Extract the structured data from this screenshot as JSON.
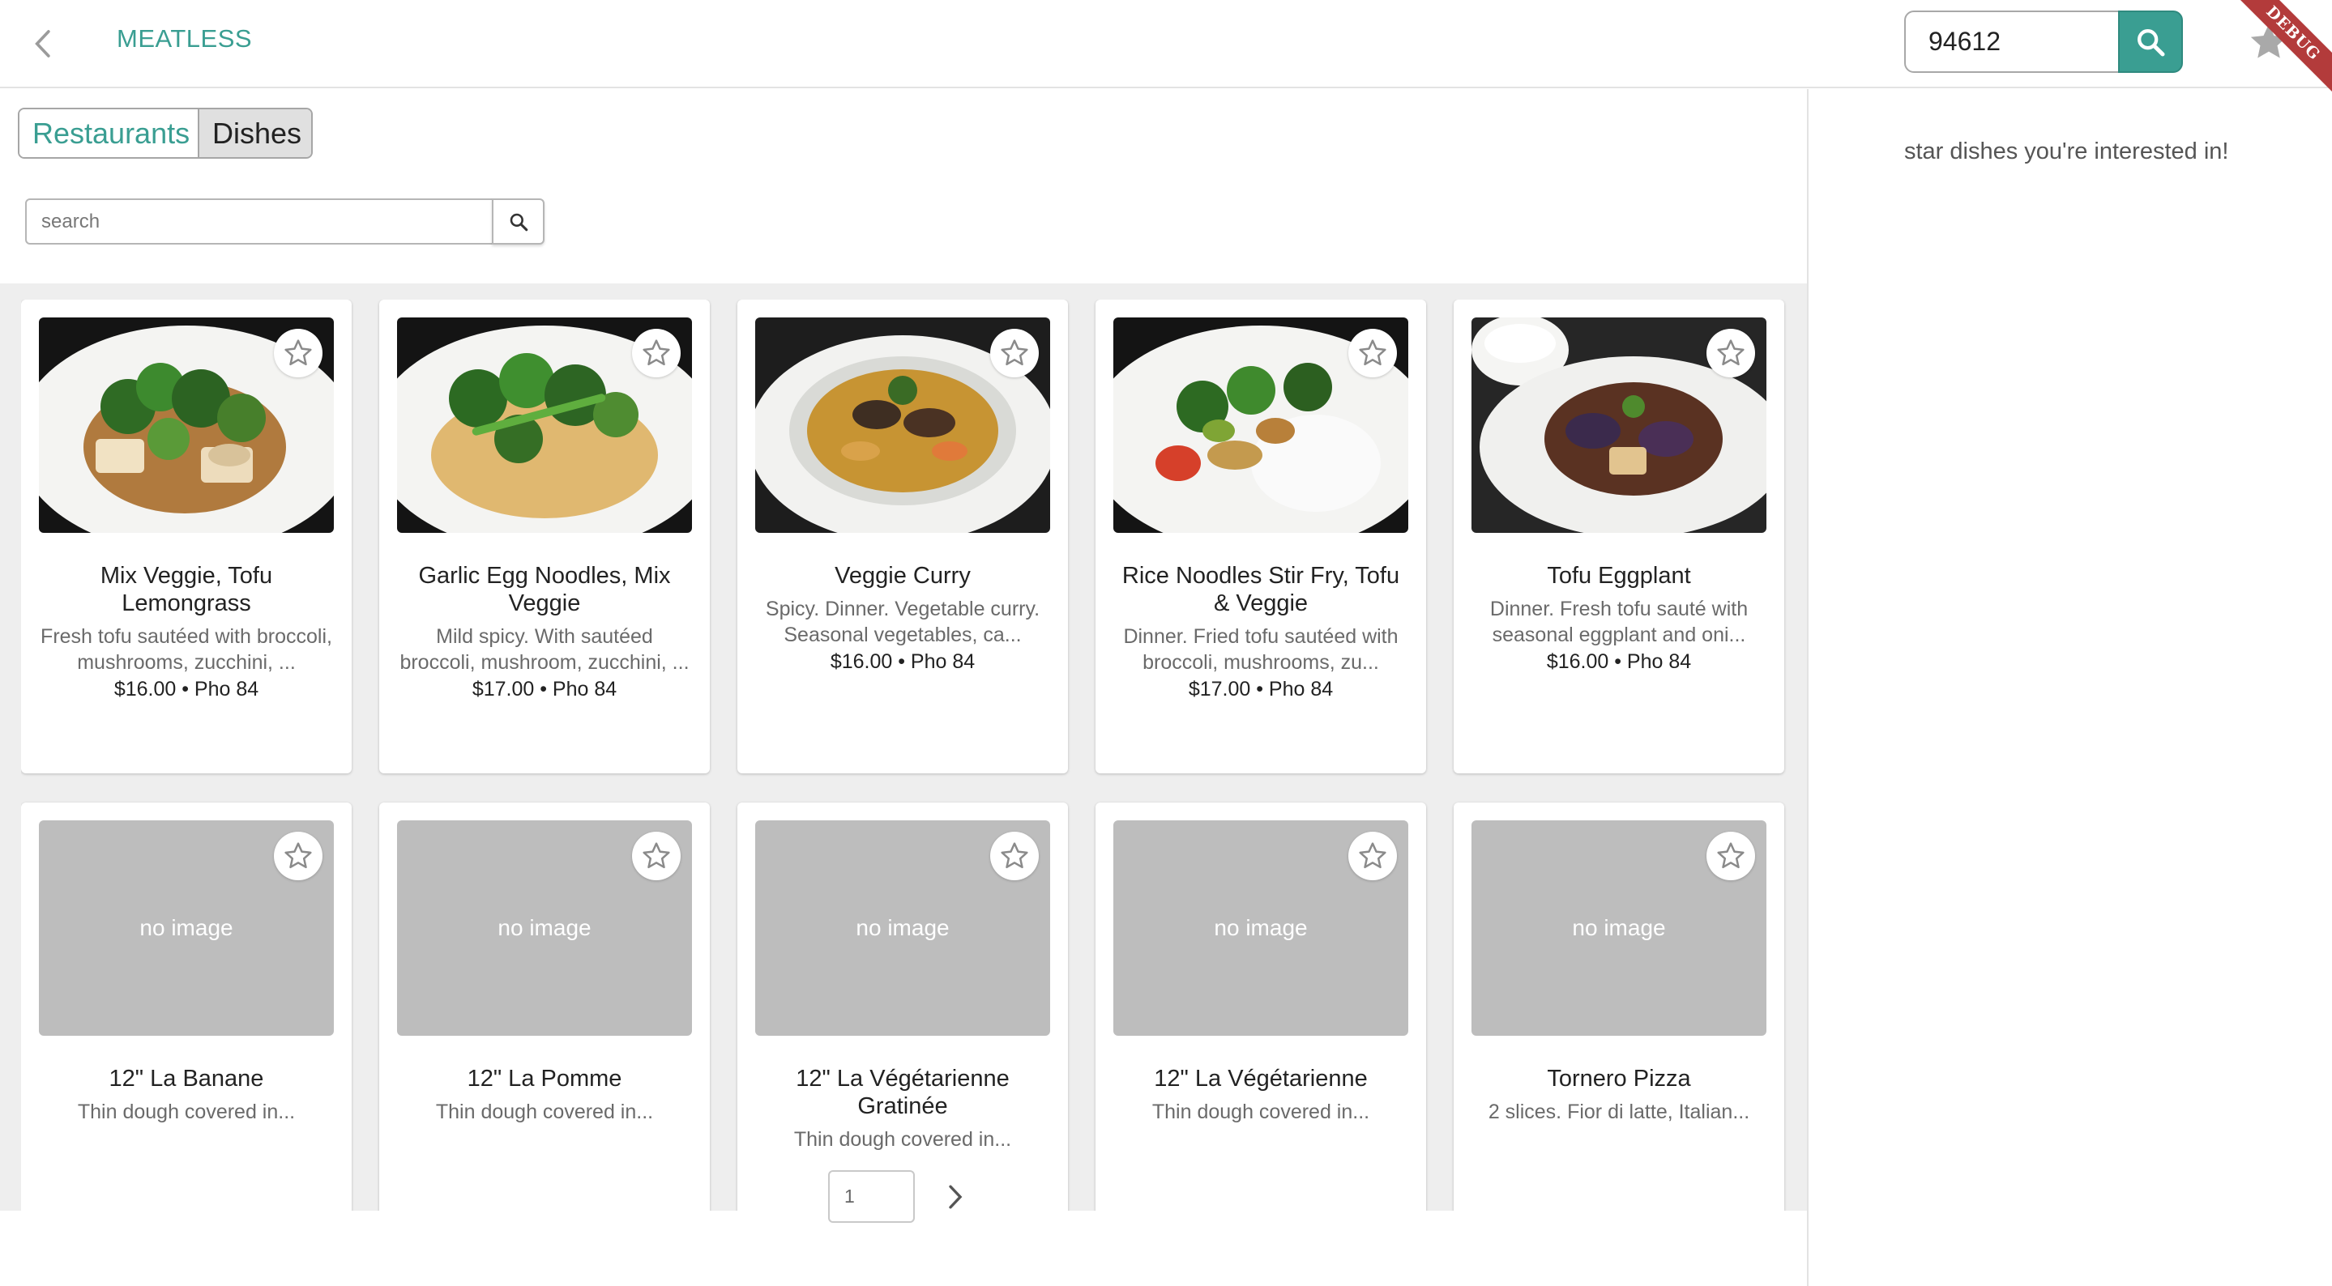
{
  "app": {
    "title": "MEATLESS",
    "debug_label": "DEBUG"
  },
  "location": {
    "zip_value": "94612"
  },
  "tabs": {
    "restaurants": "Restaurants",
    "dishes": "Dishes"
  },
  "search": {
    "placeholder": "search",
    "value": ""
  },
  "sidebar": {
    "hint": "star dishes you're interested in!"
  },
  "no_image_label": "no image",
  "dishes": [
    {
      "name": "Mix Veggie, Tofu Lemongrass",
      "description": "Fresh tofu sautéed with broccoli, mushrooms, zucchini, ...",
      "price": "$16.00",
      "restaurant": "Pho 84",
      "meta": "$16.00 • Pho 84",
      "image": "photo"
    },
    {
      "name": "Garlic Egg Noodles, Mix Veggie",
      "description": "Mild spicy. With sautéed broccoli, mushroom, zucchini, ...",
      "price": "$17.00",
      "restaurant": "Pho 84",
      "meta": "$17.00 • Pho 84",
      "image": "photo"
    },
    {
      "name": "Veggie Curry",
      "description": "Spicy. Dinner. Vegetable curry. Seasonal vegetables, ca...",
      "price": "$16.00",
      "restaurant": "Pho 84",
      "meta": "$16.00 • Pho 84",
      "image": "photo"
    },
    {
      "name": "Rice Noodles Stir Fry, Tofu & Veggie",
      "description": "Dinner. Fried tofu sautéed with broccoli, mushrooms, zu...",
      "price": "$17.00",
      "restaurant": "Pho 84",
      "meta": "$17.00 • Pho 84",
      "image": "photo"
    },
    {
      "name": "Tofu Eggplant",
      "description": "Dinner. Fresh tofu sauté with seasonal eggplant and oni...",
      "price": "$16.00",
      "restaurant": "Pho 84",
      "meta": "$16.00 • Pho 84",
      "image": "photo"
    },
    {
      "name": "12\" La Banane",
      "description": "Thin dough covered in...",
      "image": "none"
    },
    {
      "name": "12\" La Pomme",
      "description": "Thin dough covered in...",
      "image": "none"
    },
    {
      "name": "12\" La Végétarienne Gratinée",
      "description": "Thin dough covered in...",
      "image": "none"
    },
    {
      "name": "12\" La Végétarienne",
      "description": "Thin dough covered in...",
      "image": "none"
    },
    {
      "name": "Tornero Pizza",
      "description": "2 slices. Fior di latte, Italian...",
      "image": "none"
    }
  ],
  "pagination": {
    "page": "1"
  },
  "colors": {
    "accent": "#3a9e92",
    "debug_ribbon": "#b33b3b",
    "placeholder_image": "#bdbdbd"
  },
  "icons": {
    "back": "chevron-left-icon",
    "search": "search-icon",
    "favorites": "star-icon",
    "favorite_toggle": "star-outline-icon",
    "next_page": "chevron-right-icon"
  }
}
